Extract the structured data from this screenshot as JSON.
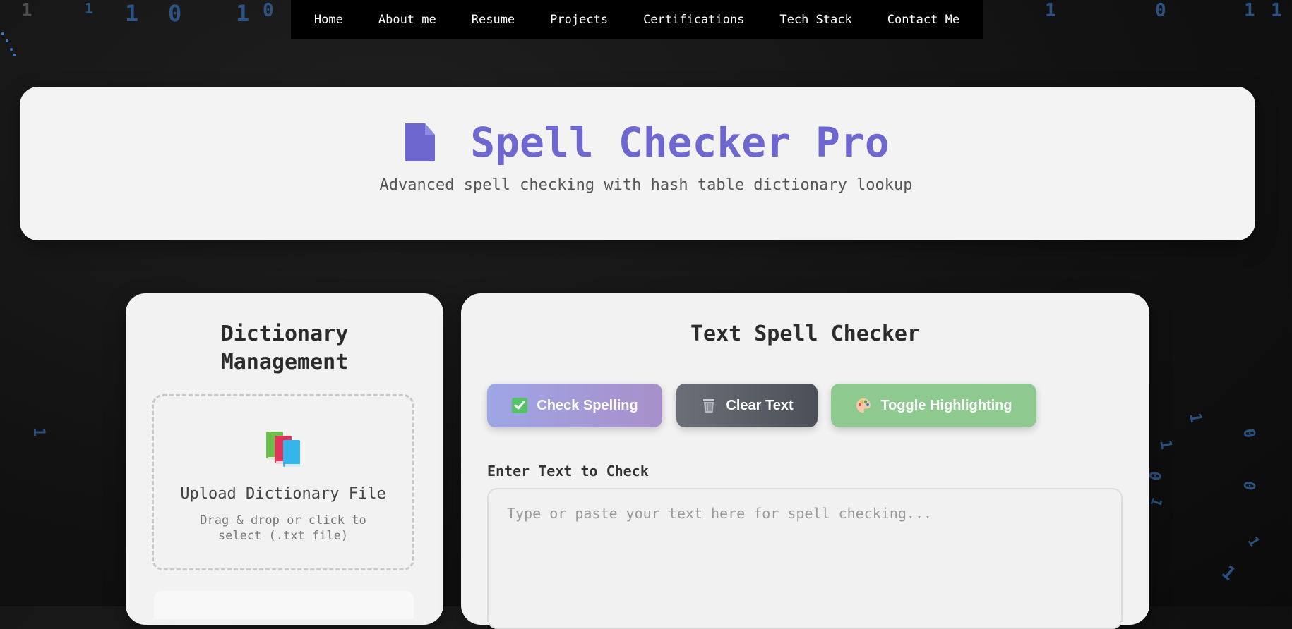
{
  "nav": {
    "items": [
      "Home",
      "About me",
      "Resume",
      "Projects",
      "Certifications",
      "Tech Stack",
      "Contact Me"
    ]
  },
  "background": {
    "digits_top": [
      "1",
      "1",
      "1",
      "0",
      "1",
      "0",
      "1",
      "0",
      "1",
      "1"
    ],
    "digits_right": [
      "1",
      "0",
      "1",
      "0",
      "1",
      "0",
      "1",
      "1"
    ],
    "digit_left": "1",
    "digit_accent_color": "#2e5e96"
  },
  "hero": {
    "icon": "document-icon",
    "title": "Spell Checker Pro",
    "subtitle": "Advanced spell checking with hash table dictionary lookup",
    "title_color": "#6d67cf"
  },
  "dictionary": {
    "heading": "Dictionary Management",
    "upload_icon": "books-icon",
    "upload_title": "Upload Dictionary File",
    "upload_hint": "Drag & drop or click to select (.txt file)"
  },
  "checker": {
    "heading": "Text Spell Checker",
    "buttons": {
      "check": {
        "label": "Check Spelling",
        "icon": "check-mark-icon"
      },
      "clear": {
        "label": "Clear Text",
        "icon": "trash-icon"
      },
      "toggle": {
        "label": "Toggle Highlighting",
        "icon": "palette-icon"
      }
    },
    "input_label": "Enter Text to Check",
    "input_placeholder": "Type or paste your text here for spell checking...",
    "input_value": ""
  }
}
